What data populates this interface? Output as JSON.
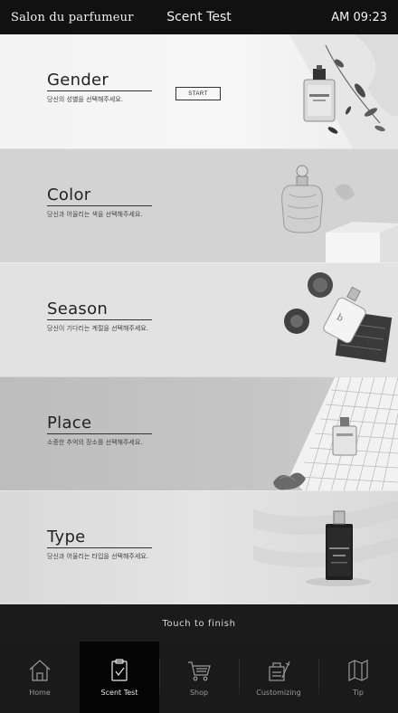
{
  "status": {
    "brand": "Salon du parfumeur",
    "title": "Scent Test",
    "time": "AM 09:23"
  },
  "panels": [
    {
      "title": "Gender",
      "subtitle": "당신의 성별을 선택해주세요.",
      "button": "START"
    },
    {
      "title": "Color",
      "subtitle": "당신과 어울리는 색을 선택해주세요."
    },
    {
      "title": "Season",
      "subtitle": "당신이 기다리는 계절을 선택해주세요."
    },
    {
      "title": "Place",
      "subtitle": "소중한 추억의 장소를 선택해주세요."
    },
    {
      "title": "Type",
      "subtitle": "당신과 어울리는 타입을 선택해주세요."
    }
  ],
  "finish_label": "Touch to finish",
  "tabs": [
    {
      "label": "Home",
      "icon": "home-icon",
      "active": false
    },
    {
      "label": "Scent Test",
      "icon": "clipboard-check-icon",
      "active": true
    },
    {
      "label": "Shop",
      "icon": "cart-icon",
      "active": false
    },
    {
      "label": "Customizing",
      "icon": "lab-tools-icon",
      "active": false
    },
    {
      "label": "Tip",
      "icon": "map-icon",
      "active": false
    }
  ],
  "colors": {
    "bar_bg": "#111111",
    "tab_bg": "#1a1a1a",
    "tab_active_bg": "#050505"
  }
}
